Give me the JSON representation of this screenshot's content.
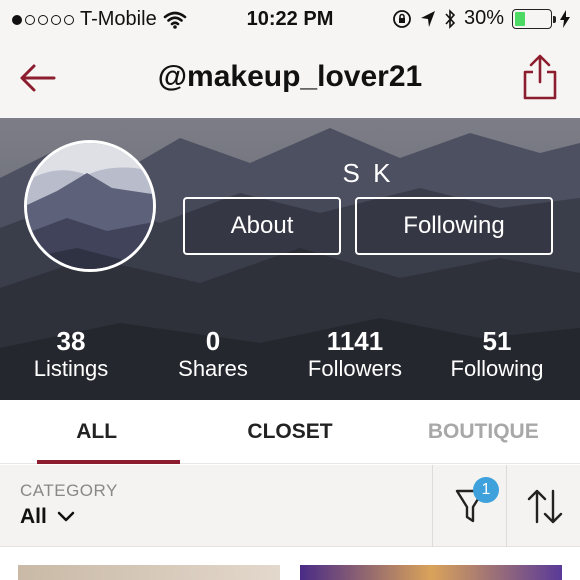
{
  "status_bar": {
    "carrier": "T-Mobile",
    "time": "10:22 PM",
    "battery_percent": "30%",
    "battery_level": 0.3,
    "signal_bars": 1,
    "signal_total": 5
  },
  "nav": {
    "title": "@makeup_lover21",
    "back_icon": "back-arrow-icon",
    "share_icon": "share-icon"
  },
  "profile": {
    "display_name": "S K",
    "about_label": "About",
    "following_button_label": "Following"
  },
  "stats": [
    {
      "value": "38",
      "label": "Listings"
    },
    {
      "value": "0",
      "label": "Shares"
    },
    {
      "value": "1141",
      "label": "Followers"
    },
    {
      "value": "51",
      "label": "Following"
    }
  ],
  "tabs": [
    {
      "label": "ALL",
      "active": true
    },
    {
      "label": "CLOSET",
      "active": false
    },
    {
      "label": "BOUTIQUE",
      "active": false
    }
  ],
  "filter": {
    "category_label": "CATEGORY",
    "category_value": "All",
    "filter_badge_count": "1"
  },
  "colors": {
    "accent": "#8c1d2e",
    "badge": "#3ea1db",
    "battery": "#4cd964"
  }
}
